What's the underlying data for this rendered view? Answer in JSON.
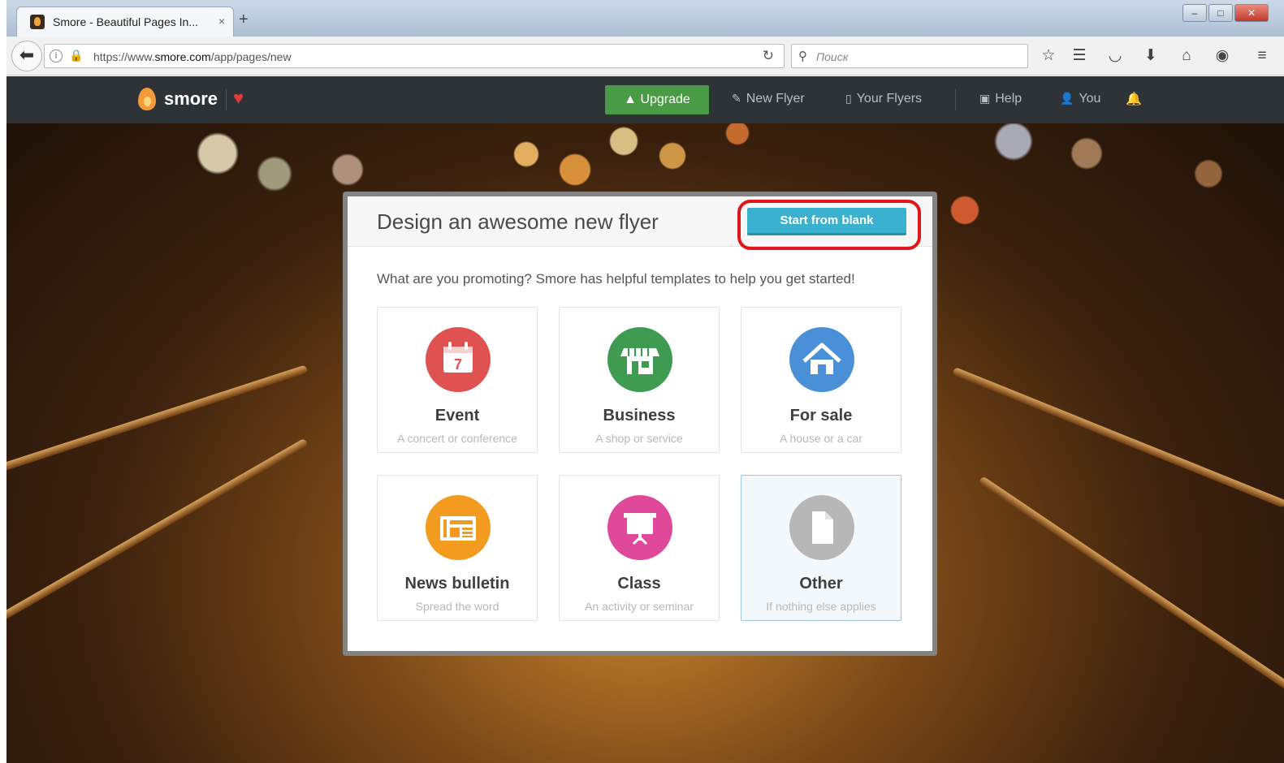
{
  "browser": {
    "tab_title": "Smore - Beautiful Pages In...",
    "tab_close": "×",
    "new_tab": "+",
    "url_prefix": "https://www.",
    "url_domain": "smore.com",
    "url_path": "/app/pages/new",
    "search_placeholder": "Поиск",
    "win_min": "–",
    "win_max": "□",
    "win_close": "✕"
  },
  "topbar": {
    "brand": "smore",
    "upgrade_label": "Upgrade",
    "new_flyer_label": "New Flyer",
    "your_flyers_label": "Your Flyers",
    "help_label": "Help",
    "you_label": "You"
  },
  "modal": {
    "title": "Design an awesome new flyer",
    "start_blank_label": "Start from blank",
    "subtitle": "What are you promoting? Smore has helpful templates to help you get started!",
    "cards": [
      {
        "label": "Event",
        "desc": "A concert or conference",
        "icon": "calendar-icon",
        "color": "#e05252"
      },
      {
        "label": "Business",
        "desc": "A shop or service",
        "icon": "storefront-icon",
        "color": "#3f9a52"
      },
      {
        "label": "For sale",
        "desc": "A house or a car",
        "icon": "house-icon",
        "color": "#4a90d9"
      },
      {
        "label": "News bulletin",
        "desc": "Spread the word",
        "icon": "newspaper-icon",
        "color": "#f29b1f"
      },
      {
        "label": "Class",
        "desc": "An activity or seminar",
        "icon": "presentation-board-icon",
        "color": "#e0489a"
      },
      {
        "label": "Other",
        "desc": "If nothing else applies",
        "icon": "document-icon",
        "color": "#b7b7b7"
      }
    ]
  },
  "colors": {
    "topbar_bg": "#2d3337",
    "upgrade_green": "#4a9b45",
    "start_blank_blue": "#3ab1cf",
    "highlight_red": "#e0161b"
  }
}
